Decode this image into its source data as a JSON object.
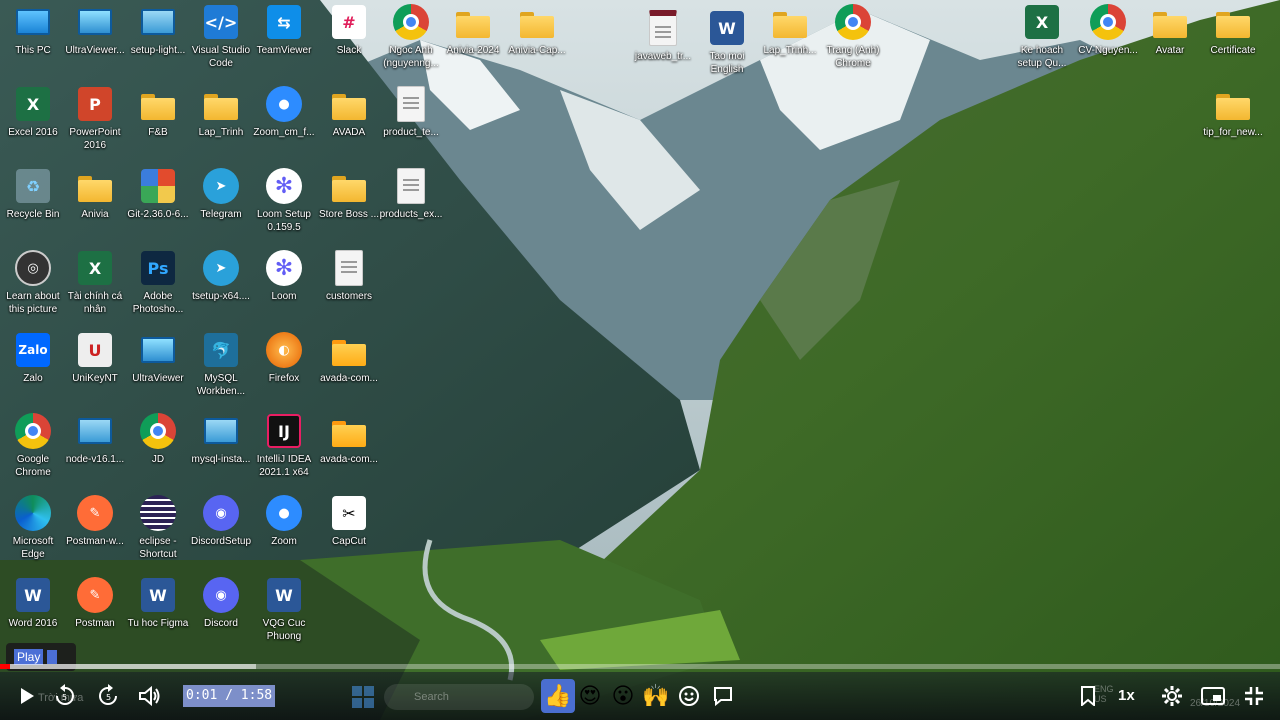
{
  "desktop": {
    "icons": [
      {
        "label": "This PC",
        "icon": "monitor-icon"
      },
      {
        "label": "UltraViewer...",
        "icon": "ultraviewer-icon"
      },
      {
        "label": "setup-light...",
        "icon": "setup-icon"
      },
      {
        "label": "Visual Studio Code",
        "icon": "vscode-icon"
      },
      {
        "label": "TeamViewer",
        "icon": "teamviewer-icon"
      },
      {
        "label": "Slack",
        "icon": "slack-icon"
      },
      {
        "label": "Ngoc Anh (nguyenng...",
        "icon": "chrome-icon"
      },
      {
        "label": "Anivia-2024",
        "icon": "folder-icon"
      },
      {
        "label": "Anivia-Cap...",
        "icon": "folder-icon"
      },
      {
        "label": "javaweb_tr...",
        "icon": "web-file-icon"
      },
      {
        "label": "Tao moi English",
        "icon": "word-icon"
      },
      {
        "label": "Lap_Trinh...",
        "icon": "folder-icon"
      },
      {
        "label": "Trang (Anh) Chrome",
        "icon": "chrome-icon"
      },
      {
        "label": "Ke hoach setup Qu...",
        "icon": "excel-icon"
      },
      {
        "label": "CV-Nguyen...",
        "icon": "chrome-doc-icon"
      },
      {
        "label": "Avatar",
        "icon": "folder-icon"
      },
      {
        "label": "Certificate",
        "icon": "folder-icon"
      },
      {
        "label": "Excel 2016",
        "icon": "excel-icon"
      },
      {
        "label": "PowerPoint 2016",
        "icon": "powerpoint-icon"
      },
      {
        "label": "F&B",
        "icon": "folder-icon"
      },
      {
        "label": "Lap_Trinh",
        "icon": "folder-icon"
      },
      {
        "label": "Zoom_cm_f...",
        "icon": "zoom-icon"
      },
      {
        "label": "AVADA",
        "icon": "folder-icon"
      },
      {
        "label": "product_te...",
        "icon": "document-icon"
      },
      {
        "label": "tip_for_new...",
        "icon": "folder-icon"
      },
      {
        "label": "Recycle Bin",
        "icon": "recycle-bin-icon"
      },
      {
        "label": "Anivia",
        "icon": "folder-icon"
      },
      {
        "label": "Git-2.36.0-6...",
        "icon": "git-icon"
      },
      {
        "label": "Telegram",
        "icon": "telegram-icon"
      },
      {
        "label": "Loom Setup 0.159.5",
        "icon": "loom-icon"
      },
      {
        "label": "Store Boss ...",
        "icon": "folder-icon"
      },
      {
        "label": "products_ex...",
        "icon": "document-icon"
      },
      {
        "label": "Learn about this picture",
        "icon": "learn-picture-icon"
      },
      {
        "label": "Tài chính cá nhân",
        "icon": "excel-icon"
      },
      {
        "label": "Adobe Photosho...",
        "icon": "photoshop-icon"
      },
      {
        "label": "tsetup-x64....",
        "icon": "telegram-icon"
      },
      {
        "label": "Loom",
        "icon": "loom-icon"
      },
      {
        "label": "customers",
        "icon": "document-icon"
      },
      {
        "label": "Zalo",
        "icon": "zalo-icon"
      },
      {
        "label": "UniKeyNT",
        "icon": "unikey-icon"
      },
      {
        "label": "UltraViewer",
        "icon": "ultraviewer-icon"
      },
      {
        "label": "MySQL Workben...",
        "icon": "mysql-icon"
      },
      {
        "label": "Firefox",
        "icon": "firefox-icon"
      },
      {
        "label": "avada-com...",
        "icon": "zip-folder-icon"
      },
      {
        "label": "Google Chrome",
        "icon": "chrome-icon"
      },
      {
        "label": "node-v16.1...",
        "icon": "installer-icon"
      },
      {
        "label": "JD",
        "icon": "chrome-doc-icon"
      },
      {
        "label": "mysql-insta...",
        "icon": "installer-icon"
      },
      {
        "label": "IntelliJ IDEA 2021.1 x64",
        "icon": "intellij-icon"
      },
      {
        "label": "avada-com...",
        "icon": "zip-folder-icon"
      },
      {
        "label": "Microsoft Edge",
        "icon": "edge-icon"
      },
      {
        "label": "Postman-w...",
        "icon": "postman-icon"
      },
      {
        "label": "eclipse - Shortcut",
        "icon": "eclipse-icon"
      },
      {
        "label": "DiscordSetup",
        "icon": "discord-icon"
      },
      {
        "label": "Zoom",
        "icon": "zoom-icon"
      },
      {
        "label": "CapCut",
        "icon": "capcut-icon"
      },
      {
        "label": "Word 2016",
        "icon": "word-icon"
      },
      {
        "label": "Postman",
        "icon": "postman-icon"
      },
      {
        "label": "Tu hoc Figma",
        "icon": "word-icon"
      },
      {
        "label": "Discord",
        "icon": "discord-icon"
      },
      {
        "label": "VQG Cuc Phuong",
        "icon": "word-icon"
      }
    ]
  },
  "player": {
    "tooltip": "Play",
    "time_display": "0:01 / 1:58",
    "progress_fraction": 0.008,
    "buffered_fraction": 0.2,
    "speed": "1x",
    "reactions": [
      "👍",
      "😍",
      "😮",
      "🙌"
    ],
    "accent": "#ff0000"
  },
  "taskbar_ghost": {
    "search": "Search",
    "lang": "ENG US",
    "date": "26/10/2024",
    "weather": "Trời mưa"
  }
}
